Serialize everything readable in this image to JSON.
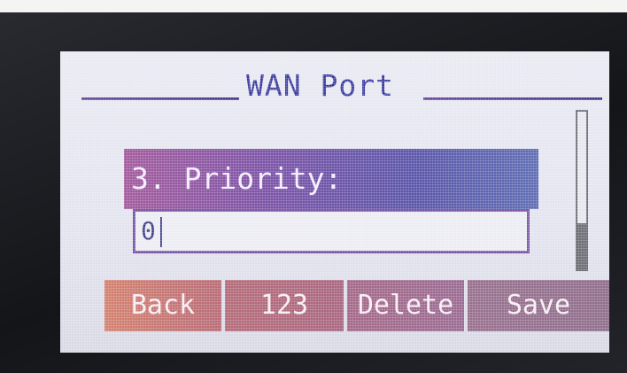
{
  "screen": {
    "title": "WAN Port",
    "field": {
      "label": "3. Priority:",
      "value": "0"
    },
    "softkeys": {
      "back": "Back",
      "mode": "123",
      "delete": "Delete",
      "save": "Save"
    }
  },
  "colors": {
    "title_text": "#3b3b9e",
    "label_bar_start": "#a25a9c",
    "label_bar_end": "#5f6db4",
    "softkey_back": "#d4806e",
    "softkey_save": "#8f6e8c",
    "screen_bg": "#e6e7f0"
  }
}
